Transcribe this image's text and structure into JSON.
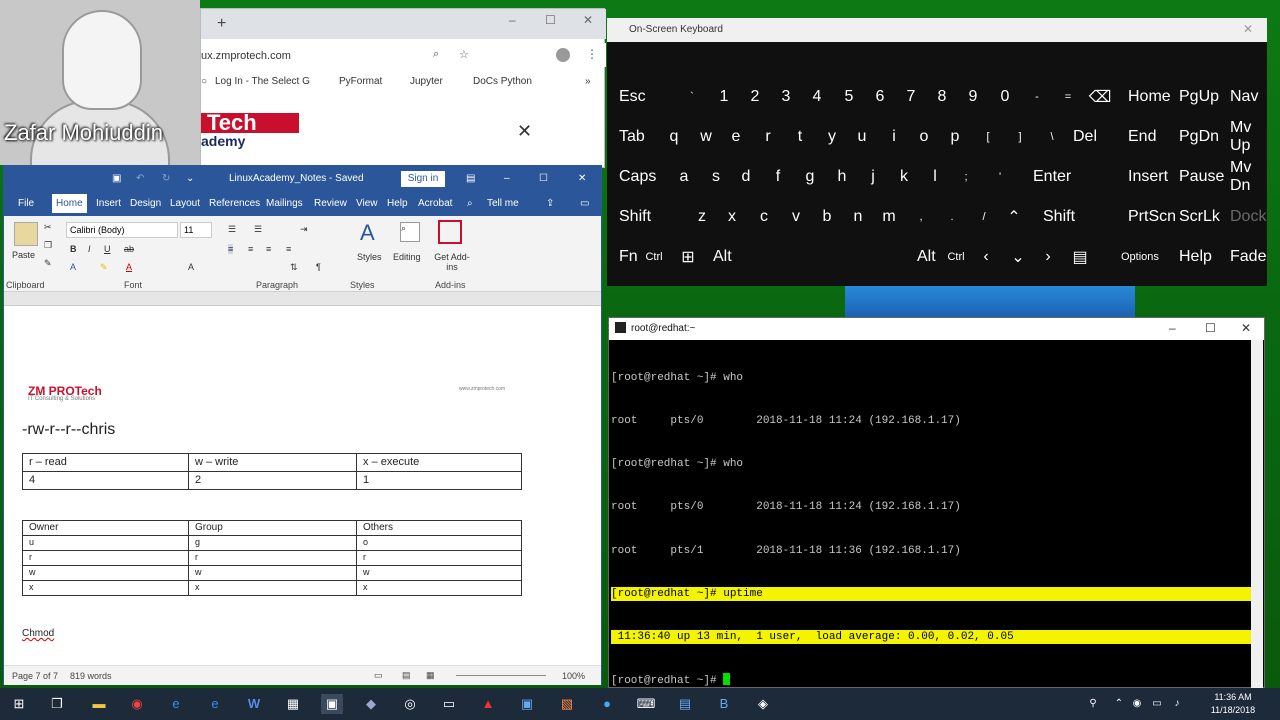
{
  "webcam": {
    "name": "Zafar Mohiuddin"
  },
  "browser": {
    "url": "ux.zmprotech.com",
    "bookmarks": [
      "Log In - The Select G",
      "PyFormat",
      "Jupyter",
      "DoCs Python"
    ],
    "logo_text": "Tech",
    "logo_sub": "ademy",
    "close": "✕"
  },
  "word": {
    "title": "LinuxAcademy_Notes - Saved",
    "signin": "Sign in",
    "menus": [
      "File",
      "Home",
      "Insert",
      "Design",
      "Layout",
      "References",
      "Mailings",
      "Review",
      "View",
      "Help",
      "Acrobat",
      "Tell me"
    ],
    "font": "Calibri (Body)",
    "size": "11",
    "groups": [
      "Clipboard",
      "Font",
      "Paragraph",
      "Styles",
      "Add-ins"
    ],
    "paste": "Paste",
    "styles": "Styles",
    "editing": "Editing",
    "addins": "Get Add-ins",
    "doc_logo": "ZM PROTech",
    "doc_logo_sub": "IT Consulting & Solutions",
    "header_right": "www.zmprotech.com",
    "perm": "-rw-r--r--chris",
    "table1": [
      [
        "r – read",
        "w – write",
        "x – execute"
      ],
      [
        "4",
        "2",
        "1"
      ]
    ],
    "table2": [
      [
        "Owner",
        "Group",
        "Others"
      ],
      [
        "u",
        "g",
        "o"
      ],
      [
        "r",
        "r",
        "r"
      ],
      [
        "w",
        "w",
        "w"
      ],
      [
        "x",
        "x",
        "x"
      ]
    ],
    "chmod": "Chmod",
    "status_page": "Page 7 of 7",
    "status_words": "819 words",
    "zoom": "100%"
  },
  "osk": {
    "title": "On-Screen Keyboard",
    "rows": [
      [
        "Esc",
        "`",
        "1",
        "2",
        "3",
        "4",
        "5",
        "6",
        "7",
        "8",
        "9",
        "0",
        "-",
        "=",
        "⌫",
        "Home",
        "PgUp",
        "Nav"
      ],
      [
        "Tab",
        "q",
        "w",
        "e",
        "r",
        "t",
        "y",
        "u",
        "i",
        "o",
        "p",
        "[",
        "]",
        "\\",
        "Del",
        "End",
        "PgDn",
        "Mv Up"
      ],
      [
        "Caps",
        "a",
        "s",
        "d",
        "f",
        "g",
        "h",
        "j",
        "k",
        "l",
        ";",
        "'",
        "Enter",
        "Insert",
        "Pause",
        "Mv Dn"
      ],
      [
        "Shift",
        "z",
        "x",
        "c",
        "v",
        "b",
        "n",
        "m",
        ",",
        ".",
        "/",
        "⌃",
        "Shift",
        "PrtScn",
        "ScrLk",
        "Dock"
      ],
      [
        "Fn",
        "Ctrl",
        "⊞",
        "Alt",
        "Alt",
        "Ctrl",
        "‹",
        "⌄",
        "›",
        "▤",
        "Options",
        "Help",
        "Fade"
      ]
    ]
  },
  "terminal": {
    "title": "root@redhat:~",
    "lines": [
      "[root@redhat ~]# who",
      "root     pts/0        2018-11-18 11:24 (192.168.1.17)",
      "[root@redhat ~]# who",
      "root     pts/0        2018-11-18 11:24 (192.168.1.17)",
      "root     pts/1        2018-11-18 11:36 (192.168.1.17)",
      "[root@redhat ~]# uptime",
      " 11:36:40 up 13 min,  1 user,  load average: 0.00, 0.02, 0.05",
      "[root@redhat ~]# "
    ]
  },
  "taskbar": {
    "time": "11:36 AM",
    "date": "11/18/2018"
  }
}
